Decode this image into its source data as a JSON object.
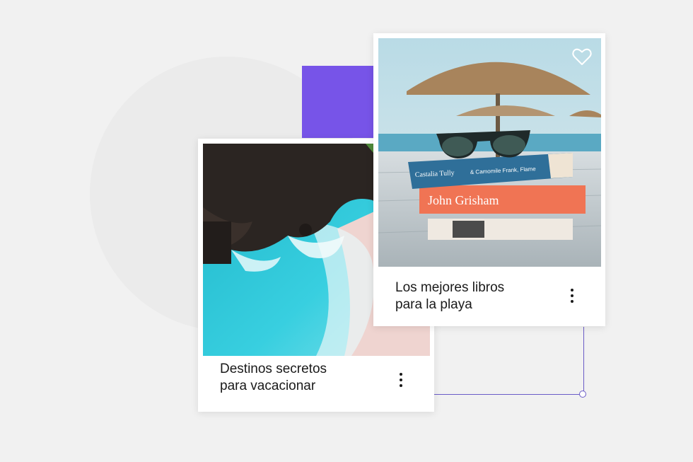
{
  "cards": [
    {
      "title": "Destinos secretos\npara vacacionar"
    },
    {
      "title": "Los mejores libros\npara la playa"
    }
  ],
  "book_spines": {
    "top_author": "Castalia Tully",
    "top_subtitle": "& Camomile Frank, Flame",
    "middle_author": "John Grisham"
  },
  "colors": {
    "accent": "#7754e8",
    "connector": "#6b5cc7",
    "text": "#1a1a1a"
  }
}
